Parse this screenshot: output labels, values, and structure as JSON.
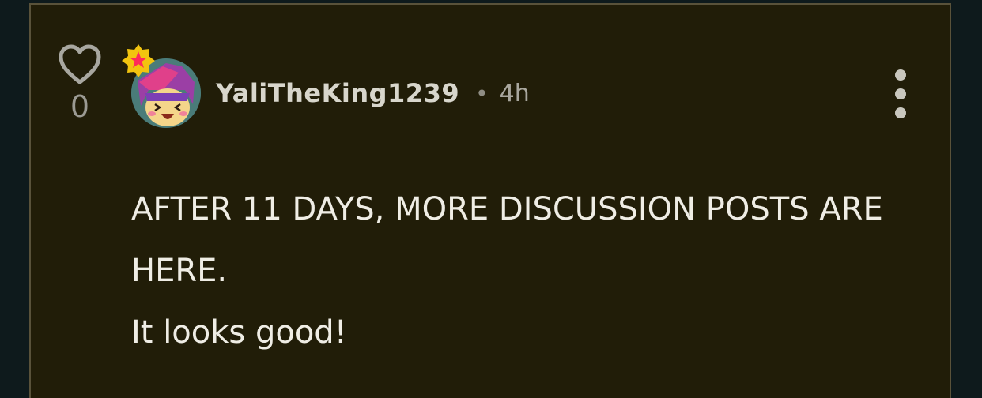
{
  "comment": {
    "like_count": "0",
    "username": "YaliTheKing1239",
    "separator": "•",
    "time": "4h",
    "body_line1": "AFTER 11 DAYS, MORE DISCUSSION POSTS ARE HERE.",
    "body_line2": "It looks good!"
  },
  "icons": {
    "like": "heart-outline-icon",
    "badge": "star-badge-icon",
    "menu": "more-vertical-icon"
  },
  "colors": {
    "card_bg": "#211d08",
    "page_bg": "#0e1a1c",
    "badge_yellow": "#f2c40f",
    "badge_star": "#ff2a5a"
  }
}
